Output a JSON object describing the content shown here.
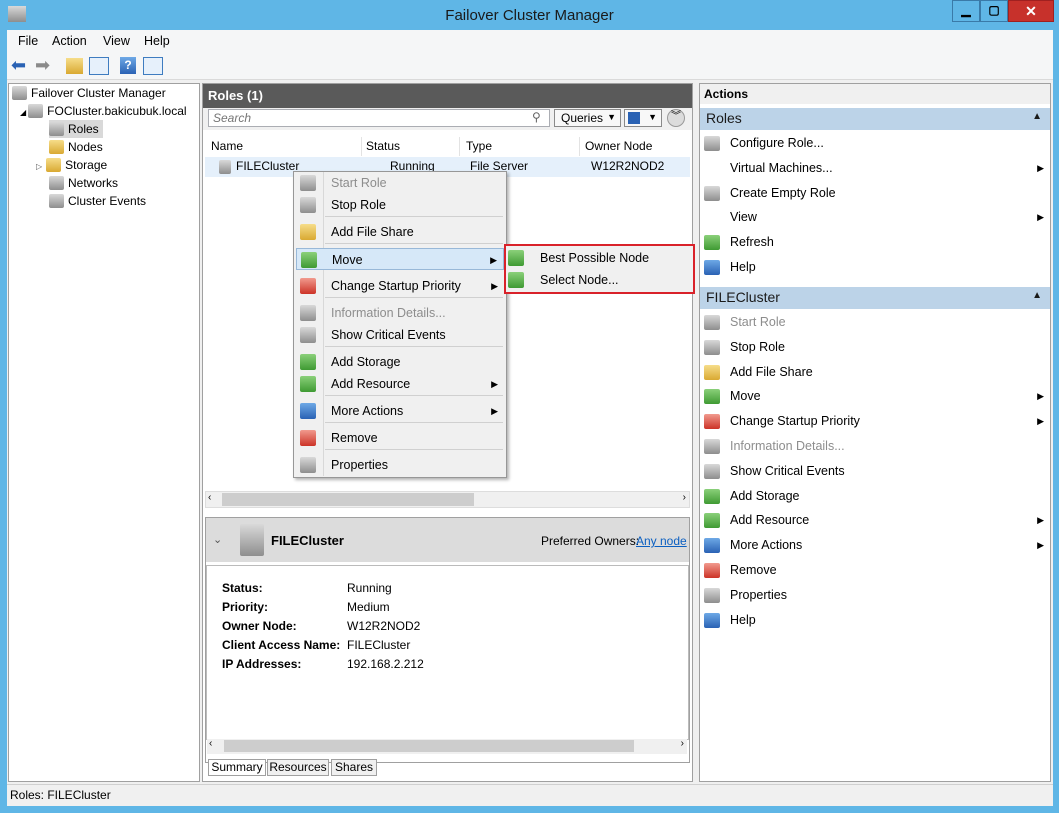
{
  "window": {
    "title": "Failover Cluster Manager",
    "min": "▁",
    "max": "▢",
    "close": "✕"
  },
  "menu": [
    "File",
    "Action",
    "View",
    "Help"
  ],
  "tree": {
    "root": "Failover Cluster Manager",
    "cluster": "FOCluster.bakicubuk.local",
    "items": [
      "Roles",
      "Nodes",
      "Storage",
      "Networks",
      "Cluster Events"
    ]
  },
  "roles": {
    "header": "Roles (1)",
    "search_placeholder": "Search",
    "queries": "Queries",
    "columns": [
      "Name",
      "Status",
      "Type",
      "Owner Node"
    ],
    "rows": [
      {
        "name": "FILECluster",
        "status": "Running",
        "type": "File Server",
        "owner": "W12R2NOD2"
      }
    ]
  },
  "context_menu": [
    {
      "label": "Start Role",
      "disabled": true,
      "icon": "start-role-icon"
    },
    {
      "label": "Stop Role",
      "icon": "stop-role-icon"
    },
    {
      "label": "Add File Share",
      "icon": "folder-icon"
    },
    {
      "label": "Move",
      "submenu": true,
      "highlighted": true,
      "icon": "move-icon"
    },
    {
      "label": "Change Startup Priority",
      "submenu": true,
      "icon": "priority-icon"
    },
    {
      "label": "Information Details...",
      "disabled": true,
      "icon": "info-details-icon"
    },
    {
      "label": "Show Critical Events",
      "icon": "events-icon"
    },
    {
      "label": "Add Storage",
      "icon": "add-storage-icon"
    },
    {
      "label": "Add Resource",
      "submenu": true,
      "icon": "add-resource-icon"
    },
    {
      "label": "More Actions",
      "submenu": true,
      "icon": "more-actions-icon"
    },
    {
      "label": "Remove",
      "icon": "remove-icon"
    },
    {
      "label": "Properties",
      "icon": "properties-icon"
    }
  ],
  "submenu": [
    "Best Possible Node",
    "Select Node..."
  ],
  "summary": {
    "title": "FILECluster",
    "preferred_owners_label": "Preferred Owners:",
    "preferred_owners_link": "Any node",
    "fields": [
      {
        "label": "Status:",
        "value": "Running"
      },
      {
        "label": "Priority:",
        "value": "Medium"
      },
      {
        "label": "Owner Node:",
        "value": "W12R2NOD2"
      },
      {
        "label": "Client Access Name:",
        "value": "FILECluster"
      },
      {
        "label": "IP Addresses:",
        "value": "192.168.2.212"
      }
    ],
    "tabs": [
      "Summary",
      "Resources",
      "Shares"
    ]
  },
  "actions": {
    "title": "Actions",
    "roles_section": "Roles",
    "roles_items": [
      {
        "label": "Configure Role...",
        "icon": "configure-role-icon"
      },
      {
        "label": "Virtual Machines...",
        "submenu": true,
        "icon": ""
      },
      {
        "label": "Create Empty Role",
        "icon": "create-role-icon"
      },
      {
        "label": "View",
        "submenu": true,
        "icon": ""
      },
      {
        "label": "Refresh",
        "icon": "refresh-icon"
      },
      {
        "label": "Help",
        "icon": "help-icon"
      }
    ],
    "file_section": "FILECluster",
    "file_items": [
      {
        "label": "Start Role",
        "disabled": true,
        "icon": "start-role-icon"
      },
      {
        "label": "Stop Role",
        "icon": "stop-role-icon"
      },
      {
        "label": "Add File Share",
        "icon": "folder-icon"
      },
      {
        "label": "Move",
        "submenu": true,
        "icon": "move-icon"
      },
      {
        "label": "Change Startup Priority",
        "submenu": true,
        "icon": "priority-icon"
      },
      {
        "label": "Information Details...",
        "disabled": true,
        "icon": "info-details-icon"
      },
      {
        "label": "Show Critical Events",
        "icon": "events-icon"
      },
      {
        "label": "Add Storage",
        "icon": "add-storage-icon"
      },
      {
        "label": "Add Resource",
        "submenu": true,
        "icon": "add-resource-icon"
      },
      {
        "label": "More Actions",
        "submenu": true,
        "icon": "more-actions-icon"
      },
      {
        "label": "Remove",
        "icon": "remove-icon"
      },
      {
        "label": "Properties",
        "icon": "properties-icon"
      },
      {
        "label": "Help",
        "icon": "help-icon"
      }
    ]
  },
  "status": {
    "text": "Roles:  FILECluster"
  },
  "colors": {
    "title_bar": "#5fb6e6",
    "section_header": "#bcd3e8",
    "highlight_border": "#d9222a",
    "close_button": "#c7312b"
  }
}
